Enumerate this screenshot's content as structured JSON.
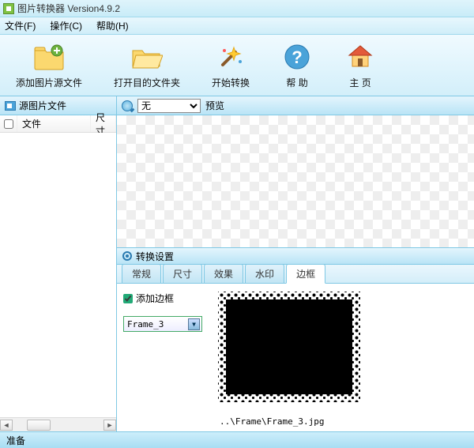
{
  "title": "图片转换器 Version4.9.2",
  "menu": {
    "file": "文件(F)",
    "operate": "操作(C)",
    "help": "帮助(H)"
  },
  "toolbar": {
    "add_source": "添加图片源文件",
    "open_dest": "打开目的文件夹",
    "start_convert": "开始转换",
    "help_btn": "帮 助",
    "home_btn": "主 页"
  },
  "left": {
    "header": "源图片文件",
    "col_file": "文件",
    "col_size": "尺寸"
  },
  "preview": {
    "select_value": "无",
    "label": "预览"
  },
  "settings": {
    "header": "转换设置",
    "tabs": {
      "general": "常规",
      "size": "尺寸",
      "effect": "效果",
      "watermark": "水印",
      "border": "边框"
    },
    "add_border_label": "添加边框",
    "frame_value": "Frame_3",
    "frame_path": "..\\Frame\\Frame_3.jpg"
  },
  "status": "准备"
}
